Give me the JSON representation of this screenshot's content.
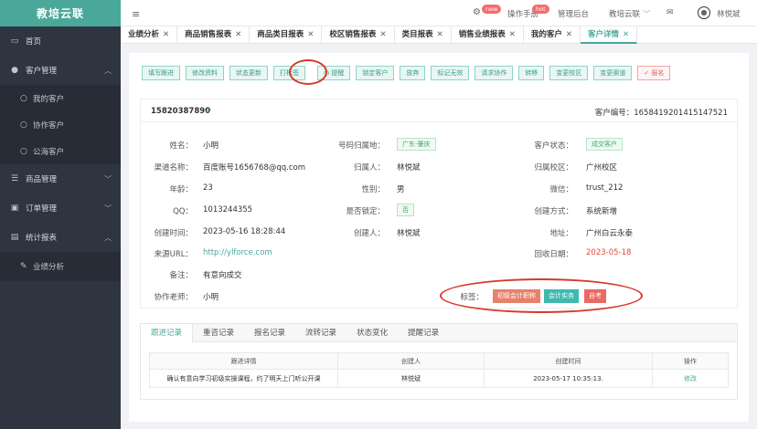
{
  "app": {
    "logo": "教培云联"
  },
  "sidebar": {
    "items": [
      {
        "label": "首页",
        "icon": "monitor-icon"
      },
      {
        "label": "客户管理",
        "icon": "user-icon"
      },
      {
        "label": "我的客户"
      },
      {
        "label": "协作客户"
      },
      {
        "label": "公海客户"
      },
      {
        "label": "商品管理",
        "icon": "list-icon"
      },
      {
        "label": "订单管理",
        "icon": "order-icon"
      },
      {
        "label": "统计报表",
        "icon": "chart-icon"
      },
      {
        "label": "业绩分析",
        "icon": "edit-icon"
      }
    ]
  },
  "topbar": {
    "manual": "操作手册",
    "manual_badge": "hot",
    "new_badge": "new",
    "admin": "管理后台",
    "org": "教培云联",
    "user": "林悦斌"
  },
  "tabs": [
    {
      "label": "业绩分析"
    },
    {
      "label": "商品销售报表"
    },
    {
      "label": "商品类目报表"
    },
    {
      "label": "校区销售报表"
    },
    {
      "label": "类目报表"
    },
    {
      "label": "销售业绩报表"
    },
    {
      "label": "我的客户"
    },
    {
      "label": "客户详情"
    }
  ],
  "actions": [
    "填写跟进",
    "修改资料",
    "状态更新",
    "打标签",
    "提醒",
    "锁定客户",
    "放弃",
    "标记无效",
    "请求协作",
    "转移",
    "变更校区",
    "变更渠道",
    "报名"
  ],
  "customer": {
    "phone": "15820387890",
    "number_label": "客户编号：",
    "number": "16584192014151475​21",
    "fields": {
      "name_label": "姓名：",
      "name": "小明",
      "channel_label": "渠道名称：",
      "channel": "百度账号1656768@qq.com",
      "age_label": "年龄：",
      "age": "23",
      "qq_label": "QQ：",
      "qq": "1013244355",
      "created_label": "创建时间：",
      "created": "2023-05-16 18:28:44",
      "url_label": "来源URL：",
      "url": "http://ylforce.com",
      "note_label": "备注：",
      "note": "有意向成交",
      "teacher_label": "协作老师：",
      "teacher": "小明",
      "region_label": "号码归属地：",
      "region": "广东-肇庆",
      "owner_label": "归属人：",
      "owner": "林悦斌",
      "gender_label": "性别：",
      "gender": "男",
      "locked_label": "是否锁定：",
      "locked": "否",
      "creator_label": "创建人：",
      "creator": "林悦斌",
      "status_label": "客户状态：",
      "status": "成交客户",
      "campus_label": "归属校区：",
      "campus": "广州校区",
      "wechat_label": "微信：",
      "wechat": "trust_212",
      "method_label": "创建方式：",
      "method": "系统新增",
      "address_label": "地址：",
      "address": "广州白云永泰",
      "recycle_label": "回收日期：",
      "recycle": "2023-05-18",
      "tags_label": "标签："
    },
    "tags": [
      {
        "label": "初级会计职称",
        "color": "#e8816a"
      },
      {
        "label": "会计实务",
        "color": "#3fb9b0"
      },
      {
        "label": "自考",
        "color": "#ea6a63"
      }
    ]
  },
  "records": {
    "tabs": [
      "跟进记录",
      "重咨记录",
      "报名记录",
      "流转记录",
      "状态变化",
      "提醒记录"
    ],
    "columns": [
      "跟进详情",
      "创建人",
      "创建时间",
      "操作"
    ],
    "rows": [
      {
        "detail": "确认有意向学习初级实操课程，约了明天上门听公开课",
        "creator": "林悦斌",
        "time": "2023-05-17 10:35:13.",
        "op": "修改"
      }
    ]
  }
}
